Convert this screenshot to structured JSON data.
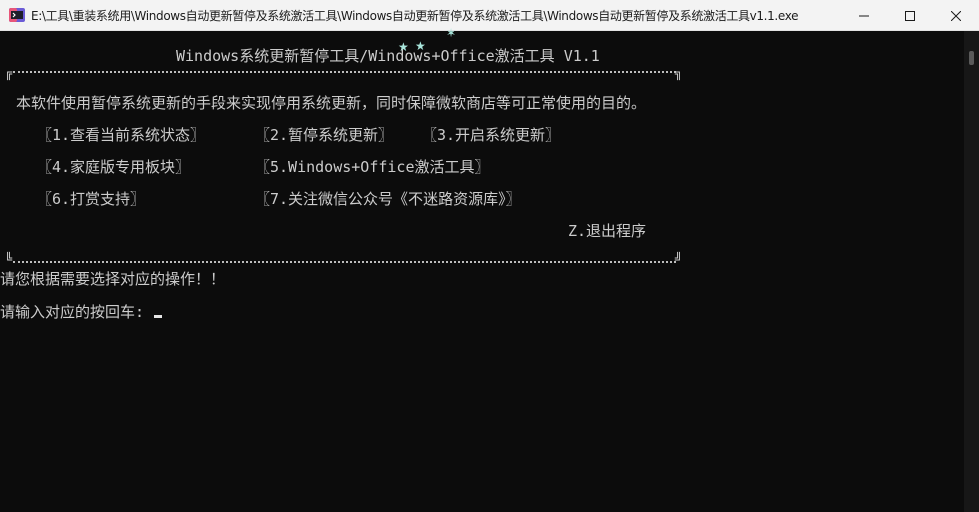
{
  "window": {
    "title": "E:\\工具\\重装系统用\\Windows自动更新暂停及系统激活工具\\Windows自动更新暂停及系统激活工具\\Windows自动更新暂停及系统激活工具v1.1.exe"
  },
  "console": {
    "header": "Windows系统更新暂停工具/Windows+Office激活工具 V1.1",
    "description": "本软件使用暂停系统更新的手段来实现停用系统更新，同时保障微软商店等可正常使用的目的。",
    "menu": {
      "item1": "〖1.查看当前系统状态〗",
      "item2": "〖2.暂停系统更新〗",
      "item3": "〖3.开启系统更新〗",
      "item4": "〖4.家庭版专用板块〗",
      "item5": "〖5.Windows+Office激活工具〗",
      "item6": "〖6.打赏支持〗",
      "item7": "〖7.关注微信公众号《不迷路资源库》〗",
      "exit": "Z.退出程序"
    },
    "prompt_line": "请您根据需要选择对应的操作！！",
    "input_prompt": "请输入对应的按回车:"
  },
  "colors": {
    "console_bg": "#0c0c0c",
    "console_text": "#cccccc",
    "titlebar_bg": "#f3f3f3"
  },
  "icons": {
    "app": "console-app-icon",
    "minimize": "minimize-icon",
    "maximize": "maximize-icon",
    "close": "close-icon"
  }
}
